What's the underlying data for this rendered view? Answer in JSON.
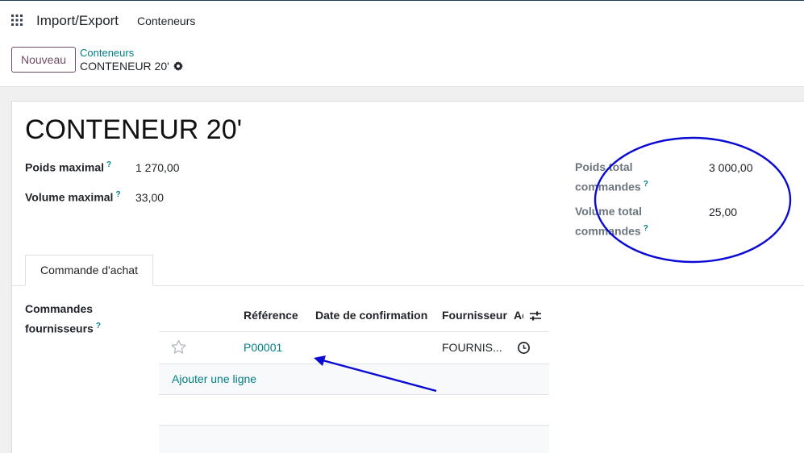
{
  "navbar": {
    "app_name": "Import/Export",
    "menu_item": "Conteneurs"
  },
  "control_panel": {
    "new_button": "Nouveau",
    "breadcrumb_parent": "Conteneurs",
    "breadcrumb_current": "CONTENEUR 20'"
  },
  "record": {
    "title": "CONTENEUR 20'",
    "fields_left": [
      {
        "label": "Poids maximal",
        "value": "1 270,00"
      },
      {
        "label": "Volume maximal",
        "value": "33,00"
      }
    ],
    "fields_right": [
      {
        "label_line1": "Poids total",
        "label_line2": "commandes",
        "value": "3 000,00"
      },
      {
        "label_line1": "Volume total",
        "label_line2": "commandes",
        "value": "25,00"
      }
    ],
    "help_marker": "?"
  },
  "tabs": [
    {
      "label": "Commande d'achat",
      "active": true
    }
  ],
  "order_list": {
    "label_line1": "Commandes",
    "label_line2": "fournisseurs",
    "columns": [
      "Référence",
      "Date de confirmation",
      "Fournisseur",
      "Ac"
    ],
    "rows": [
      {
        "reference": "P00001",
        "confirmation_date": "",
        "supplier": "FOURNIS...",
        "activity": "clock-icon"
      }
    ],
    "add_line": "Ajouter une ligne"
  },
  "annotation": {
    "color": "#0a0ad4"
  },
  "colors": {
    "brand": "#714b67",
    "link": "#017e84"
  }
}
